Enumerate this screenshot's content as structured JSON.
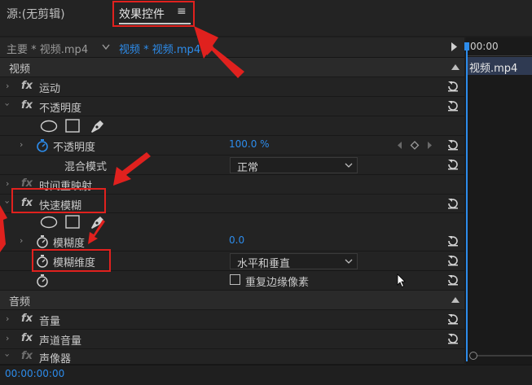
{
  "tabs": {
    "source": "源:(无剪辑)",
    "effect_controls": "效果控件",
    "menu_glyph": "≡"
  },
  "subheader": {
    "master_clip": "主要 * 视频.mp4",
    "sequence_clip": "视频 * 视频.mp4"
  },
  "timeline": {
    "time": "00:00",
    "clip": "视频.mp4"
  },
  "sections": {
    "video": "视频",
    "audio": "音频"
  },
  "effects": {
    "motion": "运动",
    "opacity": "不透明度",
    "time_remap": "时间重映射",
    "fast_blur": "快速模糊",
    "volume": "音量",
    "channel_volume": "声道音量",
    "panner": "声像器"
  },
  "props": {
    "opacity_label": "不透明度",
    "opacity_value": "100.0 %",
    "blend_label": "混合模式",
    "blend_value": "正常",
    "blurriness_label": "模糊度",
    "blurriness_value": "0.0",
    "blur_dim_label": "模糊维度",
    "blur_dim_value": "水平和垂直",
    "repeat_edge_label": "重复边缘像素"
  },
  "footer": {
    "timecode": "00:00:00:00"
  },
  "colors": {
    "accent_blue": "#2d8ceb",
    "annotation_red": "#e0211e"
  },
  "icons": [
    "ellipse-mask-icon",
    "rect-mask-icon",
    "pen-mask-icon",
    "stopwatch-icon",
    "reset-icon",
    "chevron-down-icon",
    "play-icon",
    "keyframe-icon",
    "cursor-icon"
  ]
}
